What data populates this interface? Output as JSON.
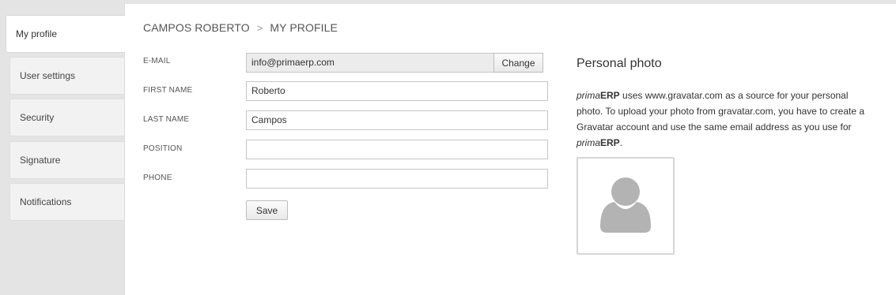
{
  "sidebar": {
    "items": [
      {
        "label": "My profile",
        "active": true
      },
      {
        "label": "User settings"
      },
      {
        "label": "Security"
      },
      {
        "label": "Signature"
      },
      {
        "label": "Notifications"
      }
    ]
  },
  "breadcrumb": {
    "parent": "CAMPOS ROBERTO",
    "separator": ">",
    "current": "MY PROFILE"
  },
  "form": {
    "email": {
      "label": "E-MAIL",
      "value": "info@primaerp.com",
      "change_label": "Change"
    },
    "first_name": {
      "label": "FIRST NAME",
      "value": "Roberto"
    },
    "last_name": {
      "label": "LAST NAME",
      "value": "Campos"
    },
    "position": {
      "label": "POSITION",
      "value": ""
    },
    "phone": {
      "label": "PHONE",
      "value": ""
    },
    "save_label": "Save"
  },
  "photo": {
    "title": "Personal photo",
    "brand_prefix": "prima",
    "brand_suffix": "ERP",
    "text_1": " uses www.gravatar.com as a source for your personal photo. To upload your photo from gravatar.com, you have to create a Gravatar account and use the same email address as you use for ",
    "text_end": ".",
    "avatar_icon": "person-silhouette-icon"
  },
  "colors": {
    "background": "#e4e4e4",
    "panel": "#ffffff",
    "readonly_field": "#ececec",
    "avatar": "#b3b3b3"
  }
}
